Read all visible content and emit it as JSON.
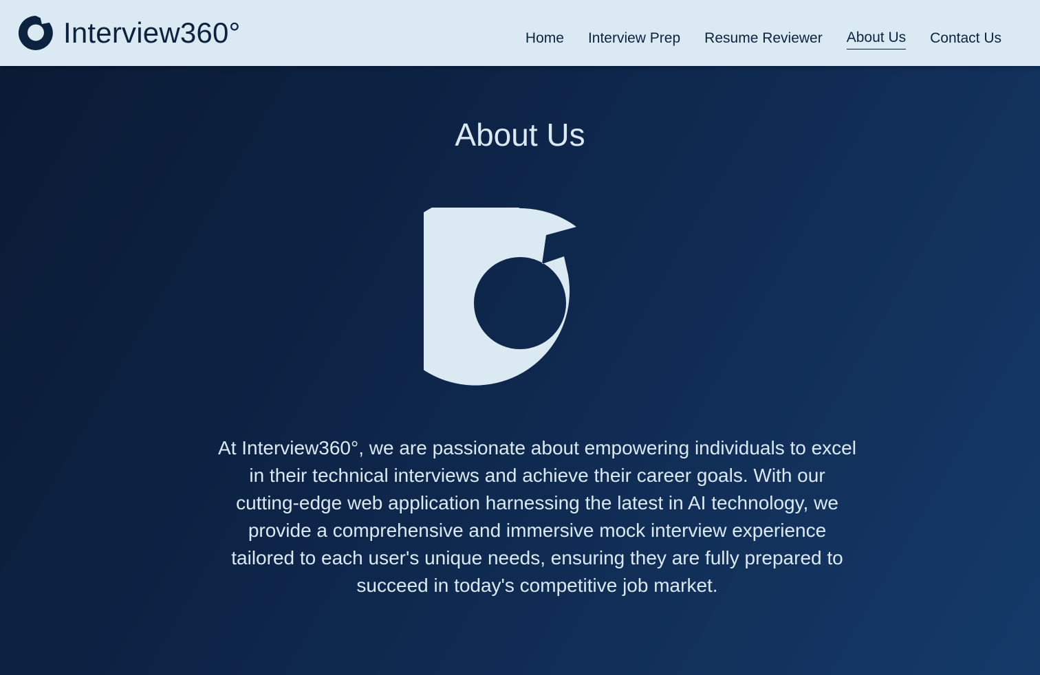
{
  "brand": {
    "name": "Interview360°",
    "logo_icon": "ring-logo-icon"
  },
  "nav": {
    "items": [
      {
        "label": "Home",
        "active": false
      },
      {
        "label": "Interview Prep",
        "active": false
      },
      {
        "label": "Resume Reviewer",
        "active": false
      },
      {
        "label": "About Us",
        "active": true
      },
      {
        "label": "Contact Us",
        "active": false
      }
    ]
  },
  "main": {
    "title": "About Us",
    "hero_icon": "ring-logo-icon",
    "paragraph": "At Interview360°, we are passionate about empowering individuals to excel in their technical interviews and achieve their career goals. With our cutting-edge web application harnessing the latest in AI technology, we provide a comprehensive and immersive mock interview experience tailored to each user's unique needs, ensuring they are fully prepared to succeed in today's competitive job market."
  },
  "colors": {
    "navbar_bg": "#dbe9f3",
    "brand_text": "#0c2340",
    "page_bg_dark": "#0a1a33",
    "page_bg_light": "#153a69",
    "content_text": "#dbe9f3"
  }
}
